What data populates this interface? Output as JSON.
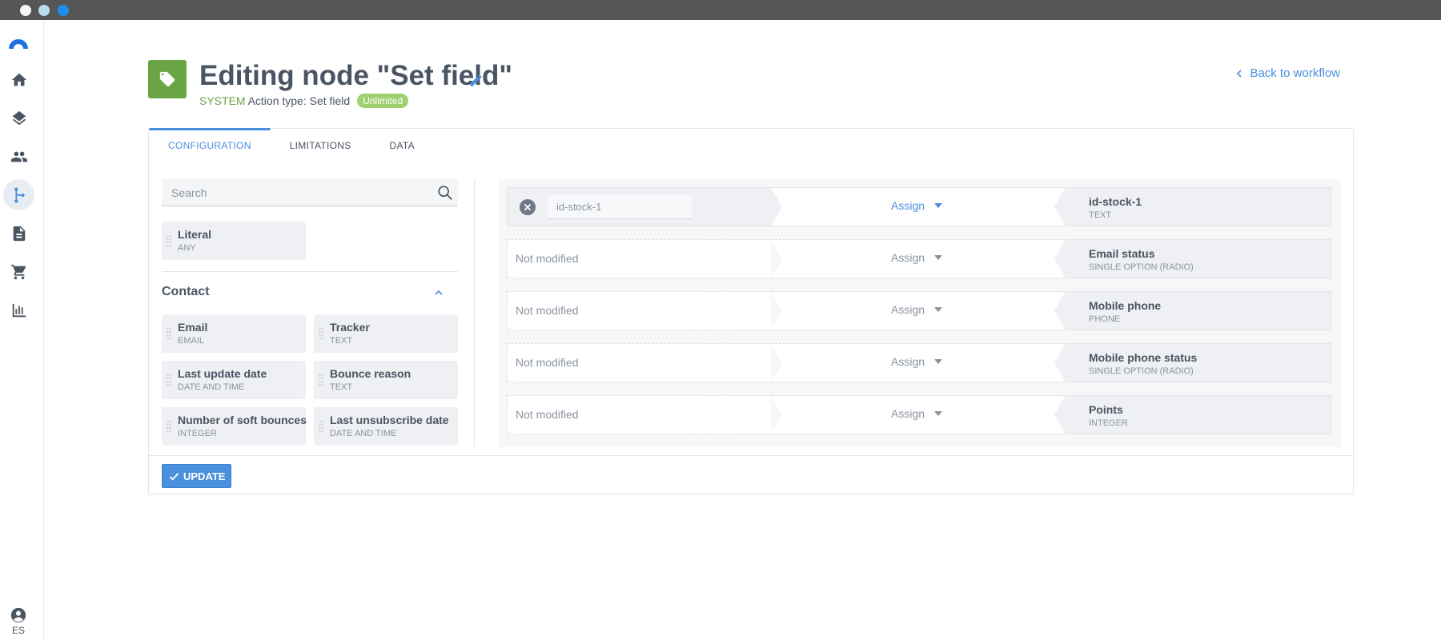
{
  "window": {
    "controls": [
      "close",
      "minimize",
      "maximize"
    ]
  },
  "sidebar": {
    "logo": "brand-logo",
    "items": [
      {
        "name": "home-icon"
      },
      {
        "name": "layers-icon"
      },
      {
        "name": "contacts-icon"
      },
      {
        "name": "workflow-icon",
        "active": true
      },
      {
        "name": "document-icon"
      },
      {
        "name": "cart-icon"
      },
      {
        "name": "reports-icon"
      }
    ],
    "user_lang": "ES"
  },
  "header": {
    "title": "Editing node \"Set field\"",
    "system_label": "SYSTEM",
    "action_type": "Action type: Set field",
    "badge": "Unlimited",
    "back_link": "Back to workflow",
    "badge_color": "#6aa545"
  },
  "tabs": [
    {
      "label": "CONFIGURATION",
      "active": true
    },
    {
      "label": "LIMITATIONS"
    },
    {
      "label": "DATA"
    }
  ],
  "palette": {
    "search_placeholder": "Search",
    "literal": {
      "name": "Literal",
      "type": "ANY"
    },
    "section_title": "Contact",
    "fields": [
      {
        "name": "Email",
        "type": "EMAIL"
      },
      {
        "name": "Tracker",
        "type": "TEXT"
      },
      {
        "name": "Last update date",
        "type": "DATE AND TIME"
      },
      {
        "name": "Bounce reason",
        "type": "TEXT"
      },
      {
        "name": "Number of soft bounces",
        "type": "INTEGER"
      },
      {
        "name": "Last unsubscribe date",
        "type": "DATE AND TIME"
      }
    ]
  },
  "mapping": {
    "rows": [
      {
        "source_value": "id-stock-1",
        "operation": "Assign",
        "target_name": "id-stock-1",
        "target_type": "TEXT"
      },
      {
        "source": "Not modified",
        "operation": "Assign",
        "target_name": "Email status",
        "target_type": "SINGLE OPTION (RADIO)"
      },
      {
        "source": "Not modified",
        "operation": "Assign",
        "target_name": "Mobile phone",
        "target_type": "PHONE"
      },
      {
        "source": "Not modified",
        "operation": "Assign",
        "target_name": "Mobile phone status",
        "target_type": "SINGLE OPTION (RADIO)"
      },
      {
        "source": "Not modified",
        "operation": "Assign",
        "target_name": "Points",
        "target_type": "INTEGER"
      }
    ]
  },
  "footer": {
    "update_label": "UPDATE"
  },
  "colors": {
    "accent": "#4a8fdc",
    "green": "#6aa545",
    "badge": "#9fcf6e"
  }
}
